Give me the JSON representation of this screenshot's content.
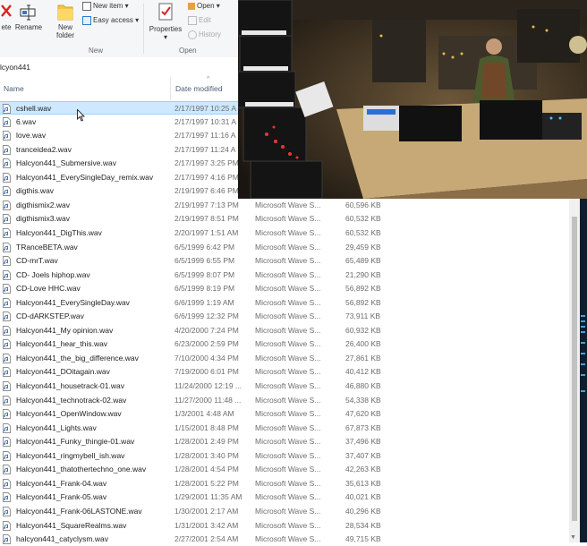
{
  "ribbon": {
    "delete_label": "ete",
    "rename_label": "Rename",
    "new_folder_label": "New\nfolder",
    "new_item_label": "New item",
    "easy_access_label": "Easy access",
    "properties_label": "Properties",
    "open_label": "Open",
    "edit_label": "Edit",
    "history_label": "History",
    "group_new": "New",
    "group_open": "Open"
  },
  "address": {
    "path": "lcyon441"
  },
  "columns": {
    "name": "Name",
    "date_modified": "Date modified"
  },
  "files": [
    {
      "name": "cshell.wav",
      "date": "2/17/1997 10:25 A",
      "type": "",
      "size": ""
    },
    {
      "name": "6.wav",
      "date": "2/17/1997 10:31 A",
      "type": "",
      "size": ""
    },
    {
      "name": "love.wav",
      "date": "2/17/1997 11:16 A",
      "type": "",
      "size": ""
    },
    {
      "name": "tranceidea2.wav",
      "date": "2/17/1997 11:24 A",
      "type": "",
      "size": ""
    },
    {
      "name": "Halcyon441_Submersive.wav",
      "date": "2/17/1997 3:25 PM",
      "type": "",
      "size": ""
    },
    {
      "name": "Halcyon441_EverySingleDay_remix.wav",
      "date": "2/17/1997 4:16 PM",
      "type": "",
      "size": ""
    },
    {
      "name": "digthis.wav",
      "date": "2/19/1997 6:46 PM",
      "type": "",
      "size": ""
    },
    {
      "name": "digthismix2.wav",
      "date": "2/19/1997 7:13 PM",
      "type": "Microsoft Wave S...",
      "size": "60,596 KB"
    },
    {
      "name": "digthismix3.wav",
      "date": "2/19/1997 8:51 PM",
      "type": "Microsoft Wave S...",
      "size": "60,532 KB"
    },
    {
      "name": "Halcyon441_DigThis.wav",
      "date": "2/20/1997 1:51 AM",
      "type": "Microsoft Wave S...",
      "size": "60,532 KB"
    },
    {
      "name": "TRanceBETA.wav",
      "date": "6/5/1999 6:42 PM",
      "type": "Microsoft Wave S...",
      "size": "29,459 KB"
    },
    {
      "name": "CD-mrT.wav",
      "date": "6/5/1999 6:55 PM",
      "type": "Microsoft Wave S...",
      "size": "65,489 KB"
    },
    {
      "name": "CD- Joels hiphop.wav",
      "date": "6/5/1999 8:07 PM",
      "type": "Microsoft Wave S...",
      "size": "21,290 KB"
    },
    {
      "name": "CD-Love HHC.wav",
      "date": "6/5/1999 8:19 PM",
      "type": "Microsoft Wave S...",
      "size": "56,892 KB"
    },
    {
      "name": "Halcyon441_EverySingleDay.wav",
      "date": "6/6/1999 1:19 AM",
      "type": "Microsoft Wave S...",
      "size": "56,892 KB"
    },
    {
      "name": "CD-dARKSTEP.wav",
      "date": "6/6/1999 12:32 PM",
      "type": "Microsoft Wave S...",
      "size": "73,911 KB"
    },
    {
      "name": "Halcyon441_My opinion.wav",
      "date": "4/20/2000 7:24 PM",
      "type": "Microsoft Wave S...",
      "size": "60,932 KB"
    },
    {
      "name": "Halcyon441_hear_this.wav",
      "date": "6/23/2000 2:59 PM",
      "type": "Microsoft Wave S...",
      "size": "26,400 KB"
    },
    {
      "name": "Halcyon441_the_big_difference.wav",
      "date": "7/10/2000 4:34 PM",
      "type": "Microsoft Wave S...",
      "size": "27,861 KB"
    },
    {
      "name": "Halcyon441_DOitagain.wav",
      "date": "7/19/2000 6:01 PM",
      "type": "Microsoft Wave S...",
      "size": "40,412 KB"
    },
    {
      "name": "Halcyon441_housetrack-01.wav",
      "date": "11/24/2000 12:19 ...",
      "type": "Microsoft Wave S...",
      "size": "46,880 KB"
    },
    {
      "name": "Halcyon441_technotrack-02.wav",
      "date": "11/27/2000 11:48 ...",
      "type": "Microsoft Wave S...",
      "size": "54,338 KB"
    },
    {
      "name": "Halcyon441_OpenWindow.wav",
      "date": "1/3/2001 4:48 AM",
      "type": "Microsoft Wave S...",
      "size": "47,620 KB"
    },
    {
      "name": "Halcyon441_Lights.wav",
      "date": "1/15/2001 8:48 PM",
      "type": "Microsoft Wave S...",
      "size": "67,873 KB"
    },
    {
      "name": "Halcyon441_Funky_thingie-01.wav",
      "date": "1/28/2001 2:49 PM",
      "type": "Microsoft Wave S...",
      "size": "37,496 KB"
    },
    {
      "name": "Halcyon441_ringmybell_ish.wav",
      "date": "1/28/2001 3:40 PM",
      "type": "Microsoft Wave S...",
      "size": "37,407 KB"
    },
    {
      "name": "Halcyon441_thatothertechno_one.wav",
      "date": "1/28/2001 4:54 PM",
      "type": "Microsoft Wave S...",
      "size": "42,263 KB"
    },
    {
      "name": "Halcyon441_Frank-04.wav",
      "date": "1/28/2001 5:22 PM",
      "type": "Microsoft Wave S...",
      "size": "35,613 KB"
    },
    {
      "name": "Halcyon441_Frank-05.wav",
      "date": "1/29/2001 11:35 AM",
      "type": "Microsoft Wave S...",
      "size": "40,021 KB"
    },
    {
      "name": "Halcyon441_Frank-06LASTONE.wav",
      "date": "1/30/2001 2:17 AM",
      "type": "Microsoft Wave S...",
      "size": "40,296 KB"
    },
    {
      "name": "Halcyon441_SquareRealms.wav",
      "date": "1/31/2001 3:42 AM",
      "type": "Microsoft Wave S...",
      "size": "28,534 KB"
    },
    {
      "name": "halcyon441_catyclysm.wav",
      "date": "2/27/2001 2:54 AM",
      "type": "Microsoft Wave S...",
      "size": "49,715 KB"
    }
  ],
  "selected_index": 0,
  "icons": {
    "file": "wav-file-icon",
    "delete": "delete-x-icon",
    "rename": "rename-icon",
    "new_folder": "folder-icon",
    "properties": "properties-checklist-icon",
    "cursor": "mouse-cursor-icon"
  },
  "colors": {
    "selection": "#cde8ff",
    "accent": "#0078d7"
  }
}
